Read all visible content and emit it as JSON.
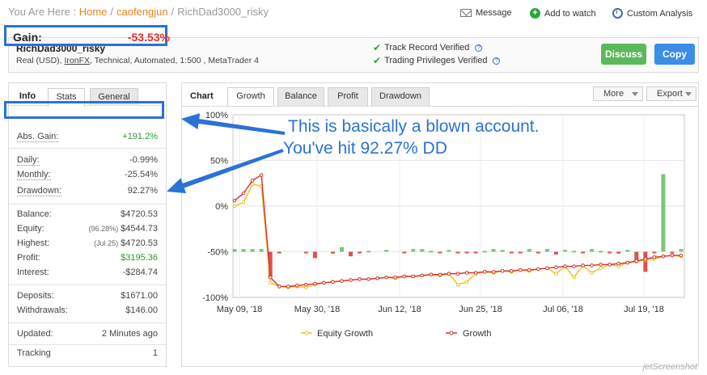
{
  "breadcrumb": {
    "prefix": "You Are Here :",
    "home": "Home",
    "user": "caofengjun",
    "current": "RichDad3000_risky"
  },
  "top_actions": {
    "message": "Message",
    "watch": "Add to watch",
    "analysis": "Custom Analysis"
  },
  "account": {
    "name": "RichDad3000_risky",
    "desc_prefix": "Real (USD),",
    "broker": "IronFX",
    "desc_suffix": ", Technical, Automated, 1:500 , MetaTrader 4",
    "verified_track": "Track Record Verified",
    "verified_priv": "Trading Privileges Verified",
    "discuss": "Discuss",
    "copy": "Copy"
  },
  "info": {
    "tabs": {
      "title": "Info",
      "stats": "Stats",
      "general": "General"
    },
    "gain_label": "Gain:",
    "gain_value": "-53.53%",
    "abs_gain_label": "Abs. Gain:",
    "abs_gain_value": "+191.2%",
    "daily_label": "Daily:",
    "daily_value": "-0.99%",
    "monthly_label": "Monthly:",
    "monthly_value": "-25.54%",
    "drawdown_label": "Drawdown:",
    "drawdown_value": "92.27%",
    "balance_label": "Balance:",
    "balance_value": "$4720.53",
    "equity_label": "Equity:",
    "equity_sub": "(96.28%)",
    "equity_value": "$4544.73",
    "highest_label": "Highest:",
    "highest_sub": "(Jul 25)",
    "highest_value": "$4720.53",
    "profit_label": "Profit:",
    "profit_value": "$3195.36",
    "interest_label": "Interest:",
    "interest_value": "-$284.74",
    "deposits_label": "Deposits:",
    "deposits_value": "$1671.00",
    "withdrawals_label": "Withdrawals:",
    "withdrawals_value": "$146.00",
    "updated_label": "Updated:",
    "updated_value": "2 Minutes ago",
    "tracking_label": "Tracking",
    "tracking_value": "1"
  },
  "chart_panel": {
    "title": "Chart",
    "tabs": [
      "Growth",
      "Balance",
      "Profit",
      "Drawdown"
    ],
    "more": "More",
    "export": "Export"
  },
  "annotation": {
    "line1": "This is basically a blown account.",
    "line2": "You've hit 92.27% DD"
  },
  "colors": {
    "growth": "#d9302b",
    "equity": "#e8c21a",
    "bar_pos": "#7cc47c",
    "bar_neg": "#e05050",
    "annot": "#2a72d6"
  },
  "watermark": "jetScreenshot",
  "chart_data": {
    "type": "line",
    "x_ticks": [
      "May 09, '18",
      "May 30, '18",
      "Jun 12, '18",
      "Jun 25, '18",
      "Jul 06, '18",
      "Jul 19, '18"
    ],
    "y_ticks": [
      "100%",
      "50%",
      "0%",
      "-50%",
      "-100%"
    ],
    "ylim": [
      -100,
      100
    ],
    "legend": [
      "Equity Growth",
      "Growth"
    ],
    "series": [
      {
        "name": "Growth",
        "values": [
          6,
          14,
          28,
          34,
          -78,
          -88,
          -88,
          -87,
          -86,
          -85,
          -84,
          -83,
          -82,
          -81,
          -80,
          -80,
          -79,
          -78,
          -78,
          -77,
          -77,
          -76,
          -75,
          -75,
          -74,
          -74,
          -73,
          -73,
          -72,
          -72,
          -71,
          -71,
          -70,
          -70,
          -69,
          -68,
          -67,
          -66,
          -66,
          -65,
          -65,
          -64,
          -64,
          -63,
          -62,
          -60,
          -58,
          -56,
          -55,
          -54,
          -54
        ]
      },
      {
        "name": "Equity Growth",
        "values": [
          0,
          4,
          24,
          22,
          -84,
          -88,
          -89,
          -88,
          -89,
          -86,
          -84,
          -83,
          -82,
          -81,
          -80,
          -80,
          -79,
          -78,
          -79,
          -77,
          -77,
          -76,
          -75,
          -76,
          -74,
          -86,
          -83,
          -74,
          -72,
          -73,
          -71,
          -72,
          -70,
          -71,
          -69,
          -68,
          -74,
          -66,
          -78,
          -65,
          -73,
          -68,
          -64,
          -66,
          -62,
          -61,
          -59,
          -58,
          -55,
          -54,
          -55
        ]
      }
    ],
    "bars": [
      -47,
      -47,
      -47,
      -47,
      -78,
      -50,
      0,
      0,
      -50,
      -57,
      0,
      -52,
      -45,
      -55,
      -50,
      -49,
      0,
      -48,
      0,
      -50,
      -47,
      -47,
      -49,
      -51,
      -48,
      -50,
      -51,
      -50,
      -49,
      -47,
      -48,
      -51,
      -50,
      -47,
      -50,
      -47,
      -53,
      -48,
      -49,
      -51,
      -47,
      -49,
      -50,
      -52,
      -48,
      -62,
      -72,
      -50,
      35,
      -50,
      -47
    ]
  }
}
